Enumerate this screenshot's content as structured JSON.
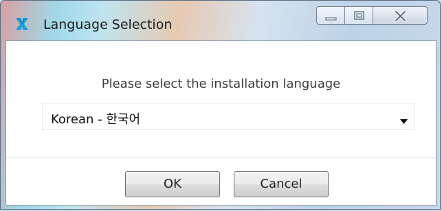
{
  "window": {
    "title": "Language Selection",
    "app_icon": "installer-logo-icon",
    "controls": {
      "minimize": "minimize-icon",
      "maximize": "maximize-icon",
      "close": "close-icon"
    }
  },
  "dialog": {
    "prompt": "Please select the installation language",
    "language_select": {
      "selected": "Korean - 한국어"
    },
    "buttons": {
      "ok": "OK",
      "cancel": "Cancel"
    }
  },
  "colors": {
    "close_glyph": "#5a6a7e",
    "logo": "#1aa3d9"
  }
}
